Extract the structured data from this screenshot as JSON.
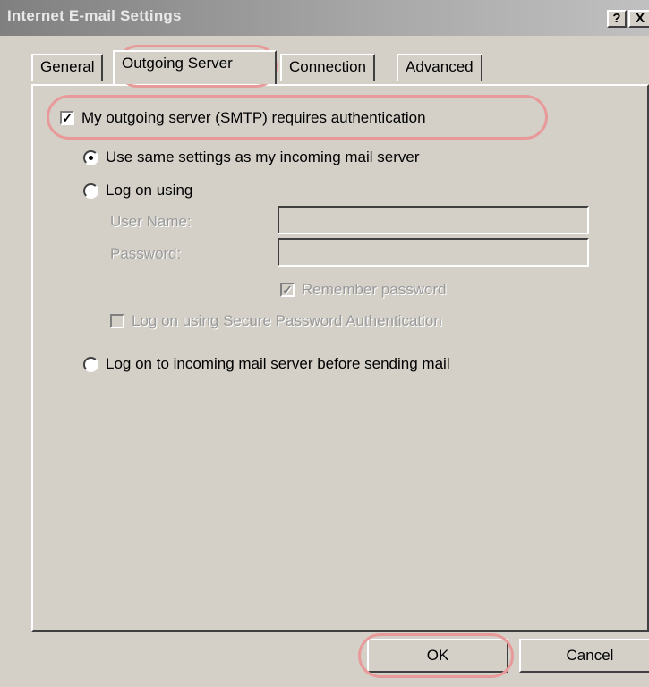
{
  "window": {
    "title": "Internet E-mail Settings",
    "help_label": "?",
    "close_label": "X"
  },
  "tabs": [
    {
      "label": "General"
    },
    {
      "label": "Outgoing Server"
    },
    {
      "label": "Connection"
    },
    {
      "label": "Advanced"
    }
  ],
  "panel": {
    "smtp_auth_label": "My outgoing server (SMTP) requires authentication",
    "smtp_auth_checked": true,
    "radio_same_label": "Use same settings as my incoming mail server",
    "radio_logon_label": "Log on using",
    "username_label": "User Name:",
    "username_value": "",
    "password_label": "Password:",
    "password_value": "",
    "remember_label": "Remember password",
    "spa_label": "Log on using Secure Password Authentication",
    "radio_incoming_label": "Log on to incoming mail server before sending mail",
    "check_mark": "✓"
  },
  "buttons": {
    "ok": "OK",
    "cancel": "Cancel"
  },
  "colors": {
    "highlight": "#e89a9a",
    "face": "#d4d0c8"
  }
}
